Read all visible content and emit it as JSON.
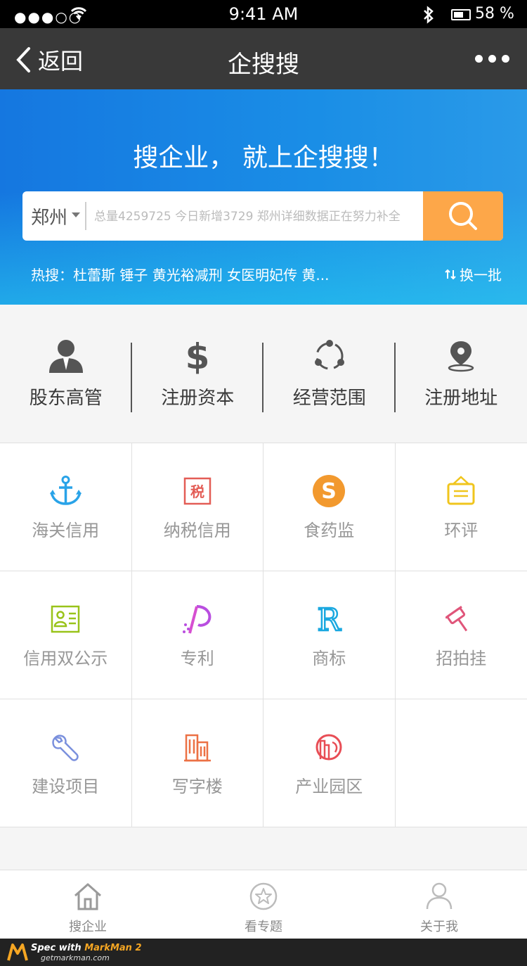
{
  "status_bar": {
    "signal": "●●●○○",
    "time": "9:41 AM",
    "battery": "58 %"
  },
  "nav": {
    "back_label": "返回",
    "title": "企搜搜"
  },
  "hero": {
    "slogan": "搜企业，  就上企搜搜！",
    "city": "郑州",
    "search_placeholder": "总量4259725 今日新增3729 郑州详细数据正在努力补全",
    "hot": "热搜：杜蕾斯 锤子 黄光裕减刑 女医明妃传 黄...",
    "refresh_label": "换一批"
  },
  "top_categories": [
    {
      "label": "股东高管"
    },
    {
      "label": "注册资本"
    },
    {
      "label": "经营范围"
    },
    {
      "label": "注册地址"
    }
  ],
  "grid": [
    [
      {
        "label": "海关信用"
      },
      {
        "label": "纳税信用"
      },
      {
        "label": "食药监"
      },
      {
        "label": "环评"
      }
    ],
    [
      {
        "label": "信用双公示"
      },
      {
        "label": "专利"
      },
      {
        "label": "商标"
      },
      {
        "label": "招拍挂"
      }
    ],
    [
      {
        "label": "建设项目"
      },
      {
        "label": "写字楼"
      },
      {
        "label": "产业园区"
      },
      {
        "label": ""
      }
    ]
  ],
  "tabs": [
    {
      "label": "搜企业"
    },
    {
      "label": "看专题"
    },
    {
      "label": "关于我"
    }
  ],
  "footer": {
    "spec_prefix": "Spec with ",
    "spec_brand": "MarkMan 2",
    "site": "getmarkman.com"
  },
  "colors": {
    "nav_bg": "#393939",
    "nav_text": "#ffffff",
    "search_button": "#fda749",
    "divider": "#e0e0e0",
    "label_gray": "#979797",
    "tab_icon": "#bcbcbc"
  }
}
